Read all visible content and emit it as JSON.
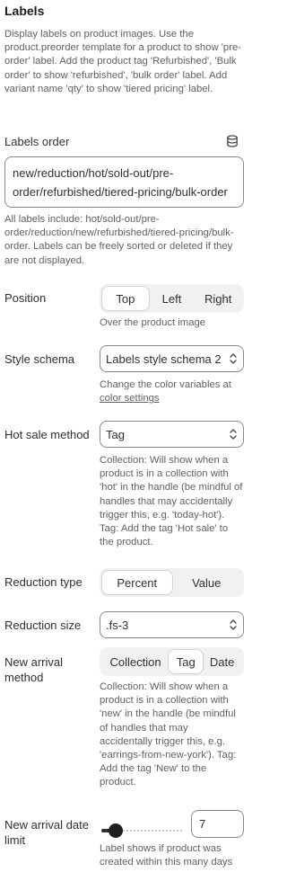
{
  "section": {
    "title": "Labels",
    "description": "Display labels on product images. Use the product.preorder template for a product to show 'pre-order' label. Add the product tag 'Refurbished', 'Bulk order' to show 'refurbished', 'bulk order' label. Add variant name 'qty' to show 'tiered pricing' label."
  },
  "labels_order": {
    "label": "Labels order",
    "icon": "database-icon",
    "value": "new/reduction/hot/sold-out/pre-order/refurbished/tiered-pricing/bulk-order",
    "hint": "All labels include: hot/sold-out/pre-order/reduction/new/refurbished/tiered-pricing/bulk-order. Labels can be freely sorted or deleted if they are not displayed."
  },
  "position": {
    "label": "Position",
    "options": [
      "Top",
      "Left",
      "Right"
    ],
    "selected": "Top",
    "hint": "Over the product image"
  },
  "style_schema": {
    "label": "Style schema",
    "value": "Labels style schema 2",
    "hint_text": "Change the color variables at ",
    "hint_link": "color settings"
  },
  "hot_sale_method": {
    "label": "Hot sale method",
    "value": "Tag",
    "hint": "Collection: Will show when a product is in a collection with 'hot' in the handle (be mindful of handles that may accidentally trigger this, e.g. 'today-hot'). Tag: Add the tag 'Hot sale' to the product."
  },
  "reduction_type": {
    "label": "Reduction type",
    "options": [
      "Percent",
      "Value"
    ],
    "selected": "Percent"
  },
  "reduction_size": {
    "label": "Reduction size",
    "value": ".fs-3"
  },
  "new_arrival_method": {
    "label": "New arrival method",
    "options": [
      "Collection",
      "Tag",
      "Date"
    ],
    "selected": "Tag",
    "hint": "Collection: Will show when a product is in a collection with 'new' in the handle (be mindful of handles that may accidentally trigger this, e.g. 'earrings-from-new-york'). Tag: Add the tag 'New' to the product."
  },
  "new_arrival_date_limit": {
    "label": "New arrival date limit",
    "value": "7",
    "slider_fraction": 0.13,
    "hint": "Label shows if product was created within this many days"
  },
  "colors": {
    "text": "#303030",
    "muted": "#616161",
    "border": "#8a8a8a",
    "segment_bg": "#f1f1f1"
  }
}
